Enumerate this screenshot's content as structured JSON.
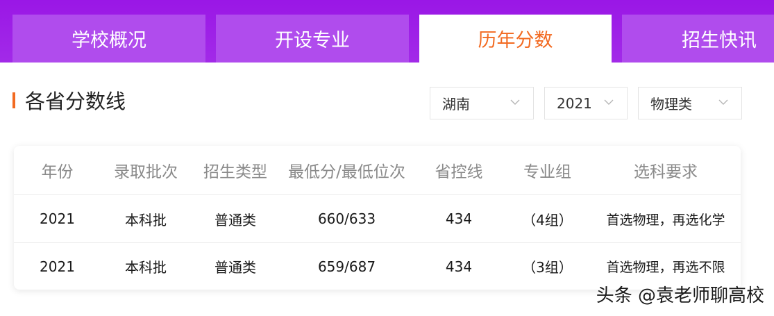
{
  "tabs": [
    {
      "label": "学校概况"
    },
    {
      "label": "开设专业"
    },
    {
      "label": "历年分数"
    },
    {
      "label": "招生快讯"
    }
  ],
  "section": {
    "title": "各省分数线"
  },
  "filters": {
    "province": "湖南",
    "year": "2021",
    "category": "物理类"
  },
  "table": {
    "headers": [
      "年份",
      "录取批次",
      "招生类型",
      "最低分/最低位次",
      "省控线",
      "专业组",
      "选科要求"
    ],
    "rows": [
      [
        "2021",
        "本科批",
        "普通类",
        "660/633",
        "434",
        "（4组）",
        "首选物理，再选化学"
      ],
      [
        "2021",
        "本科批",
        "普通类",
        "659/687",
        "434",
        "（3组）",
        "首选物理，再选不限"
      ]
    ]
  },
  "watermark": "头条 @袁老师聊高校",
  "colors": {
    "tab_bar": "#9a17e6",
    "tab_inactive": "#b04ced",
    "accent": "#f26a21"
  },
  "icons": {
    "select_arrow": "chevron-down-icon"
  }
}
